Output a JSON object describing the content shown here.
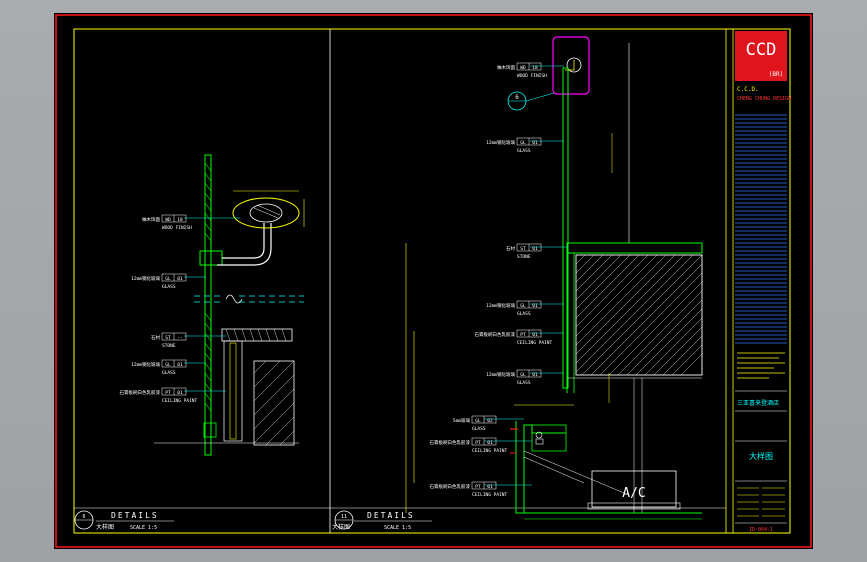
{
  "logo": {
    "text": "CCD",
    "sub": "(BR)"
  },
  "firm_lines": [
    "C.C.D.",
    "CHENG CHUNG DESIGN"
  ],
  "panel_left": {
    "number": "6",
    "title": "DETAILS",
    "subtitle": "大样图",
    "scale": "SCALE 1:5",
    "callouts": [
      {
        "text": "柚木饰面",
        "code": "WD",
        "num": "18",
        "desc": "WOOD FINISH"
      },
      {
        "text": "12mm钢化玻璃",
        "code": "GL",
        "num": "01",
        "desc": "GLASS"
      },
      {
        "text": "石材",
        "code": "ST",
        "num": "--",
        "desc": "STONE"
      },
      {
        "text": "12mm钢化玻璃",
        "code": "GL",
        "num": "01",
        "desc": "GLASS"
      },
      {
        "text": "石膏板刷白色乳胶漆",
        "code": "PT",
        "num": "01",
        "desc": "CEILING PAINT"
      }
    ]
  },
  "panel_right": {
    "number": "11",
    "title": "DETAILS",
    "subtitle": "大样图",
    "scale": "SCALE 1:5",
    "section_marker": "6",
    "callouts": [
      {
        "text": "柚木饰面",
        "code": "WD",
        "num": "18",
        "desc": "WOOD FINISH"
      },
      {
        "text": "12mm钢化玻璃",
        "code": "GL",
        "num": "01",
        "desc": "GLASS"
      },
      {
        "text": "石材",
        "code": "ST",
        "num": "01",
        "desc": "STONE"
      },
      {
        "text": "12mm钢化玻璃",
        "code": "GL",
        "num": "01",
        "desc": "GLASS"
      },
      {
        "text": "石膏板刷白色乳胶漆",
        "code": "PT",
        "num": "01",
        "desc": "CEILING PAINT"
      },
      {
        "text": "12mm钢化玻璃",
        "code": "GL",
        "num": "01",
        "desc": "GLASS"
      },
      {
        "text": "5mm玻璃",
        "code": "GL",
        "num": "02",
        "desc": "GLASS"
      },
      {
        "text": "石膏板刷白色乳胶漆",
        "code": "PT",
        "num": "01",
        "desc": "CEILING PAINT"
      },
      {
        "text": "石膏板刷白色乳胶漆",
        "code": "PT",
        "num": "01",
        "desc": "CEILING PAINT"
      }
    ],
    "ac_label": "A/C"
  },
  "title_block": {
    "project": "三亚喜来登酒店",
    "drawing_title": "大样图",
    "drawing_no": "ID-004-1"
  },
  "colors": {
    "frame_red": "#ff1a1a",
    "frame_yellow": "#ffff00",
    "green": "#00ff00",
    "cyan": "#00ffff",
    "white": "#ffffff",
    "magenta": "#ff00ff",
    "blue": "#2a7bff"
  }
}
